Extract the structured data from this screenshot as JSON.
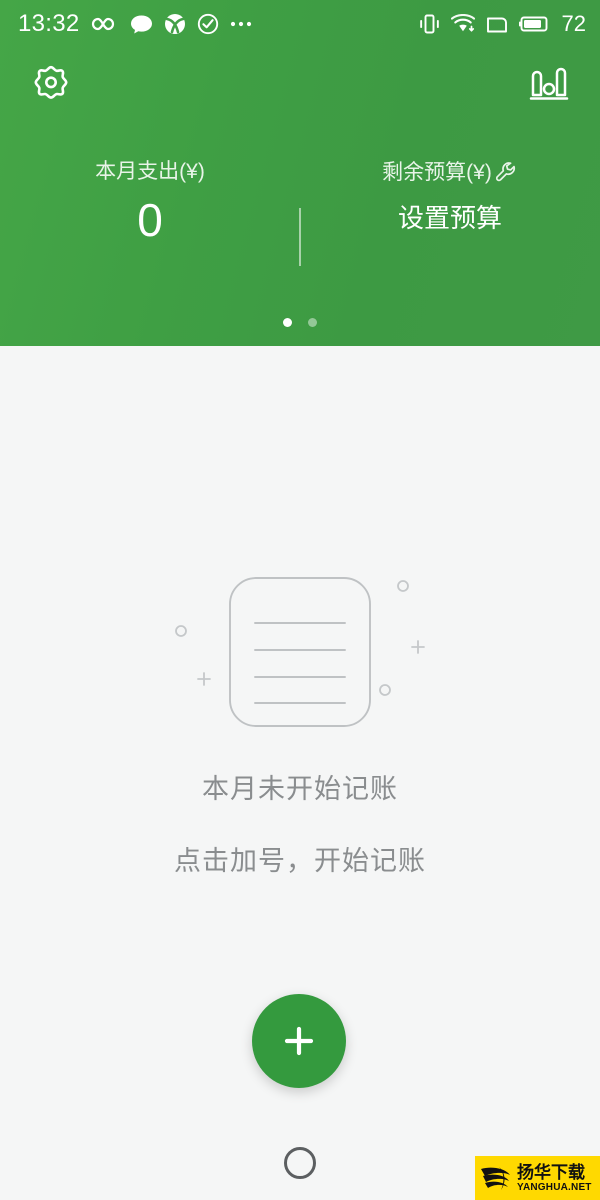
{
  "status_bar": {
    "time": "13:32",
    "left_icons": [
      "infinity-icon",
      "message-bubble-icon",
      "swirl-ball-icon",
      "check-circle-icon",
      "more-dots-icon"
    ],
    "right_icons": [
      "vibrate-icon",
      "wifi-download-icon",
      "sim-card-icon",
      "battery-icon"
    ],
    "battery_level": "72"
  },
  "header": {
    "settings_icon": "gear-icon",
    "chart_icon": "bar-chart-icon",
    "accent_color": "#3f9f44",
    "stats": [
      {
        "label": "本月支出(¥)",
        "value": "0",
        "has_wrench": false
      },
      {
        "label": "剩余预算(¥)",
        "value": "设置预算",
        "has_wrench": true,
        "wrench_icon": "wrench-icon"
      }
    ],
    "page_dots": {
      "count": 2,
      "active_index": 0
    }
  },
  "empty_state": {
    "illustration": "notepad-lines-icon",
    "title": "本月未开始记账",
    "subtitle": "点击加号，开始记账",
    "text_color": "#8a8d8f"
  },
  "fab": {
    "icon": "plus-icon",
    "color": "#349a3e"
  },
  "nav_bar": {
    "home_icon": "home-circle-icon"
  },
  "watermark": {
    "logo_icon": "globe-swoosh-logo",
    "cn_text": "扬华下载",
    "en_text": "YANGHUA.NET",
    "background_color": "#ffd900"
  }
}
